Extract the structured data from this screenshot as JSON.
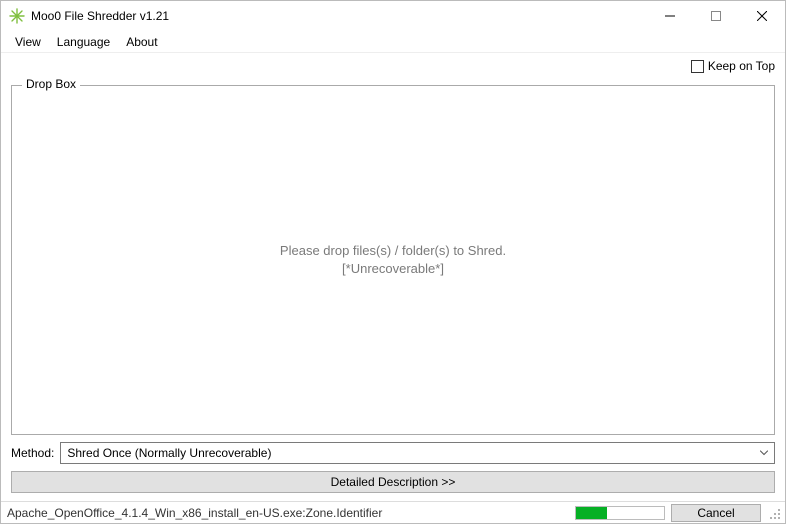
{
  "window": {
    "title": "Moo0 File Shredder v1.21"
  },
  "menubar": {
    "view": "View",
    "language": "Language",
    "about": "About"
  },
  "keep_on_top": {
    "label": "Keep on Top",
    "checked": false
  },
  "dropbox": {
    "legend": "Drop Box",
    "line1": "Please drop files(s) / folder(s) to Shred.",
    "line2": "[*Unrecoverable*]"
  },
  "method": {
    "label": "Method:",
    "selected": "Shred Once (Normally Unrecoverable)"
  },
  "description_button": "Detailed Description >>",
  "status": {
    "text": "Apache_OpenOffice_4.1.4_Win_x86_install_en-US.exe:Zone.Identifier",
    "progress_percent": 35,
    "cancel": "Cancel"
  },
  "colors": {
    "progress_fill": "#06b025"
  }
}
